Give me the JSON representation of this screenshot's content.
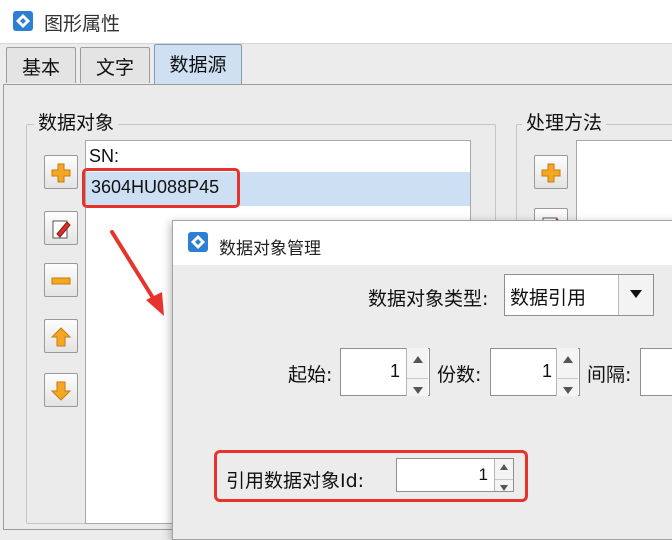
{
  "window": {
    "title": "图形属性",
    "tabs": [
      {
        "label": "基本"
      },
      {
        "label": "文字"
      },
      {
        "label": "数据源",
        "active": true
      }
    ]
  },
  "data_source": {
    "group_label": "数据对象",
    "list_items": [
      "SN:",
      "3604HU088P45"
    ],
    "selected_index": 1,
    "process_group_label": "处理方法"
  },
  "icons": {
    "add": "plus-icon",
    "edit": "edit-icon",
    "remove": "minus-icon",
    "up": "arrow-up-icon",
    "down": "arrow-down-icon",
    "app": "app-logo-icon"
  },
  "dialog": {
    "title": "数据对象管理",
    "object_type_label": "数据对象类型:",
    "object_type_value": "数据引用",
    "start_label": "起始:",
    "start_value": "1",
    "copies_label": "份数:",
    "copies_value": "1",
    "interval_label": "间隔:",
    "ref_label": "引用数据对象Id:",
    "ref_value": "1"
  },
  "colors": {
    "highlight": "#e8322c",
    "selection": "#cde0f3",
    "active_tab": "#cfe0f2",
    "icon_orange": "#f6a623"
  }
}
